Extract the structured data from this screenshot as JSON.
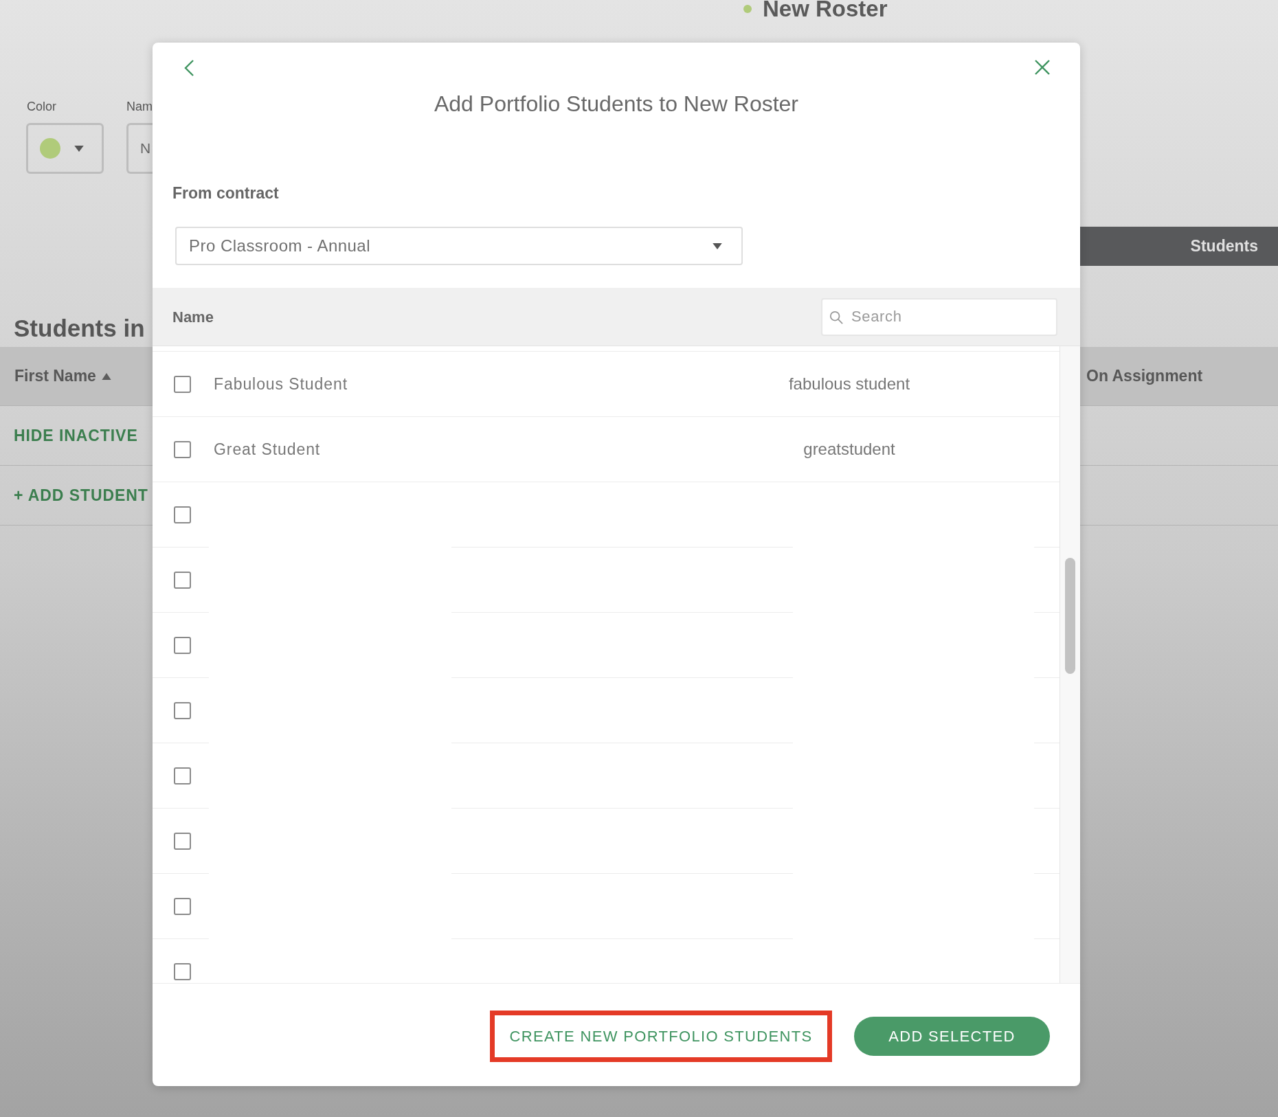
{
  "background_page": {
    "roster_title": {
      "text": "New Roster",
      "color": "#b0cb7a"
    },
    "color_field": {
      "label": "Color",
      "color": "#b0cb7a"
    },
    "name_field": {
      "label": "Nam",
      "value": "N"
    },
    "tab_bar": {
      "label": "Students"
    },
    "section_title": "Students in",
    "table": {
      "columns": [
        {
          "label": "First Name",
          "sorted": true
        },
        {
          "label": "On Assignment",
          "sorted": false
        }
      ]
    },
    "actions": [
      "HIDE INACTIVE",
      "+ ADD STUDENT"
    ]
  },
  "dialog": {
    "title": "Add Portfolio Students to New Roster",
    "contract": {
      "label": "From contract",
      "value": "Pro Classroom - Annual"
    },
    "list_header": {
      "label": "Name"
    },
    "search": {
      "placeholder": "Search"
    },
    "students": [
      {
        "name": "Fabulous Student",
        "username": "fabulous student",
        "checked": false
      },
      {
        "name": "Great Student",
        "username": "greatstudent",
        "checked": false
      },
      {
        "checked": false
      },
      {
        "checked": false
      },
      {
        "checked": false
      },
      {
        "checked": false
      },
      {
        "checked": false
      },
      {
        "checked": false
      },
      {
        "checked": false
      },
      {
        "checked": false
      }
    ],
    "buttons": [
      {
        "kind": "link",
        "label": "CREATE NEW PORTFOLIO STUDENTS",
        "highlighted": true
      },
      {
        "kind": "primary",
        "label": "ADD SELECTED",
        "highlighted": false
      }
    ]
  }
}
